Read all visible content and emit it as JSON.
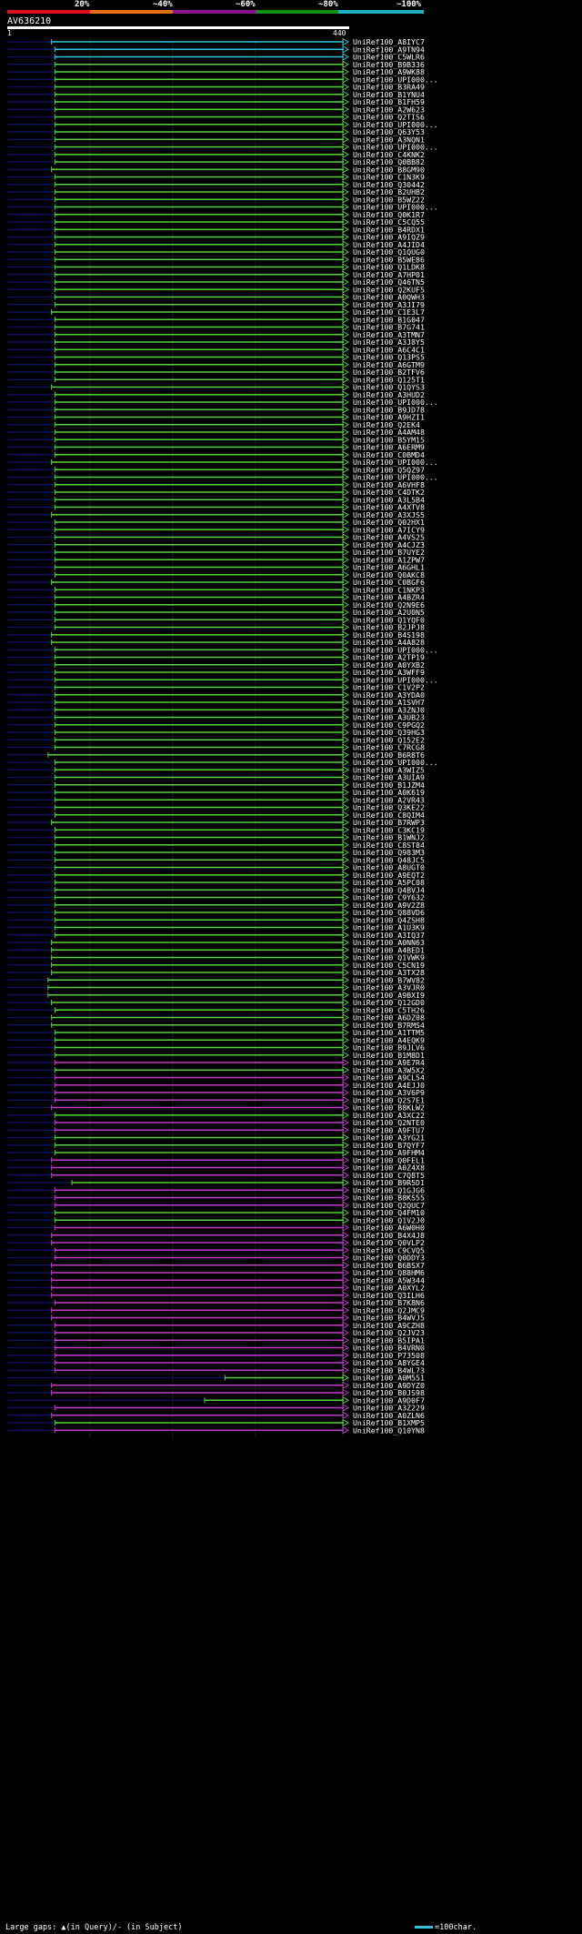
{
  "scale": {
    "labels": [
      "20%",
      "~40%",
      "~60%",
      "~80%",
      "~100%"
    ],
    "colors": [
      "#e0101e",
      "#e07010",
      "#8a128a",
      "#109010",
      "#20b0c0"
    ]
  },
  "query": {
    "name": "AV636210",
    "start": "1",
    "end": "440"
  },
  "colors": {
    "cyan": "#2ec4d6",
    "green": "#55d23c",
    "magenta": "#c03cc8",
    "navy": "#10105a",
    "gridline": "#1a1a1a"
  },
  "hits": [
    {
      "label": "UniRef100_A8IYC7",
      "color": "cyan",
      "start": 0.13
    },
    {
      "label": "UniRef100_A9TN94",
      "color": "cyan",
      "start": 0.14
    },
    {
      "label": "UniRef100_C5WLR6",
      "color": "cyan",
      "start": 0.14
    },
    {
      "label": "UniRef100_B9B336",
      "color": "green",
      "start": 0.14
    },
    {
      "label": "UniRef100_A9WK88",
      "color": "green",
      "start": 0.14
    },
    {
      "label": "UniRef100_UPI000...",
      "color": "green",
      "start": 0.14
    },
    {
      "label": "UniRef100_B3RA49",
      "color": "green",
      "start": 0.14
    },
    {
      "label": "UniRef100_B1YNU4",
      "color": "green",
      "start": 0.14
    },
    {
      "label": "UniRef100_B1FH59",
      "color": "green",
      "start": 0.14
    },
    {
      "label": "UniRef100_A2W623",
      "color": "green",
      "start": 0.14
    },
    {
      "label": "UniRef100_Q2TIS6",
      "color": "green",
      "start": 0.14
    },
    {
      "label": "UniRef100_UPI000...",
      "color": "green",
      "start": 0.14
    },
    {
      "label": "UniRef100_Q63Y53",
      "color": "green",
      "start": 0.14
    },
    {
      "label": "UniRef100_A3NQN1",
      "color": "green",
      "start": 0.14
    },
    {
      "label": "UniRef100_UPI000...",
      "color": "green",
      "start": 0.14
    },
    {
      "label": "UniRef100_C4KNK2",
      "color": "green",
      "start": 0.14
    },
    {
      "label": "UniRef100_Q0BB82",
      "color": "green",
      "start": 0.14
    },
    {
      "label": "UniRef100_B8GM90",
      "color": "green",
      "start": 0.13
    },
    {
      "label": "UniRef100_C1N3K9",
      "color": "green",
      "start": 0.14
    },
    {
      "label": "UniRef100_Q30442",
      "color": "green",
      "start": 0.14
    },
    {
      "label": "UniRef100_B2UHB2",
      "color": "green",
      "start": 0.14
    },
    {
      "label": "UniRef100_B5WZ22",
      "color": "green",
      "start": 0.14
    },
    {
      "label": "UniRef100_UPI000...",
      "color": "green",
      "start": 0.14
    },
    {
      "label": "UniRef100_Q0K1R7",
      "color": "green",
      "start": 0.14
    },
    {
      "label": "UniRef100_C5CQ55",
      "color": "green",
      "start": 0.14
    },
    {
      "label": "UniRef100_B4RDX1",
      "color": "green",
      "start": 0.14
    },
    {
      "label": "UniRef100_A9IQZ9",
      "color": "green",
      "start": 0.14
    },
    {
      "label": "UniRef100_A4JID4",
      "color": "green",
      "start": 0.14
    },
    {
      "label": "UniRef100_Q1QUG0",
      "color": "green",
      "start": 0.14
    },
    {
      "label": "UniRef100_B5WE86",
      "color": "green",
      "start": 0.14
    },
    {
      "label": "UniRef100_Q1LDK8",
      "color": "green",
      "start": 0.14
    },
    {
      "label": "UniRef100_A7HP01",
      "color": "green",
      "start": 0.14
    },
    {
      "label": "UniRef100_Q46TN5",
      "color": "green",
      "start": 0.14
    },
    {
      "label": "UniRef100_Q2KUF5",
      "color": "green",
      "start": 0.14
    },
    {
      "label": "UniRef100_A0QWH3",
      "color": "green",
      "start": 0.14
    },
    {
      "label": "UniRef100_A3JI79",
      "color": "green",
      "start": 0.14
    },
    {
      "label": "UniRef100_C1E3L7",
      "color": "green",
      "start": 0.13
    },
    {
      "label": "UniRef100_B1G047",
      "color": "green",
      "start": 0.14
    },
    {
      "label": "UniRef100_B7G741",
      "color": "green",
      "start": 0.14
    },
    {
      "label": "UniRef100_A3TMN7",
      "color": "green",
      "start": 0.14
    },
    {
      "label": "UniRef100_A3J8Y5",
      "color": "green",
      "start": 0.14
    },
    {
      "label": "UniRef100_A6C4C1",
      "color": "green",
      "start": 0.14
    },
    {
      "label": "UniRef100_Q13PS5",
      "color": "green",
      "start": 0.14
    },
    {
      "label": "UniRef100_A6GTM9",
      "color": "green",
      "start": 0.14
    },
    {
      "label": "UniRef100_B2TFV6",
      "color": "green",
      "start": 0.14
    },
    {
      "label": "UniRef100_Q125T1",
      "color": "green",
      "start": 0.14
    },
    {
      "label": "UniRef100_Q1QYS3",
      "color": "green",
      "start": 0.13
    },
    {
      "label": "UniRef100_A3HUD2",
      "color": "green",
      "start": 0.14
    },
    {
      "label": "UniRef100_UPI000...",
      "color": "green",
      "start": 0.14
    },
    {
      "label": "UniRef100_B9JD78",
      "color": "green",
      "start": 0.14
    },
    {
      "label": "UniRef100_A9HZI1",
      "color": "green",
      "start": 0.14
    },
    {
      "label": "UniRef100_Q2EK4",
      "color": "green",
      "start": 0.14
    },
    {
      "label": "UniRef100_A4AM48",
      "color": "green",
      "start": 0.14
    },
    {
      "label": "UniRef100_B5YM15",
      "color": "green",
      "start": 0.14
    },
    {
      "label": "UniRef100_A6ERM9",
      "color": "green",
      "start": 0.14
    },
    {
      "label": "UniRef100_C0BMD4",
      "color": "green",
      "start": 0.14
    },
    {
      "label": "UniRef100_UPI000...",
      "color": "green",
      "start": 0.13
    },
    {
      "label": "UniRef100_Q5QZ97",
      "color": "green",
      "start": 0.14
    },
    {
      "label": "UniRef100_UPI000...",
      "color": "green",
      "start": 0.14
    },
    {
      "label": "UniRef100_A6VHF8",
      "color": "green",
      "start": 0.14
    },
    {
      "label": "UniRef100_C4DTK2",
      "color": "green",
      "start": 0.14
    },
    {
      "label": "UniRef100_A3L5B4",
      "color": "green",
      "start": 0.14
    },
    {
      "label": "UniRef100_A4XTV8",
      "color": "green",
      "start": 0.14
    },
    {
      "label": "UniRef100_A3XJS5",
      "color": "green",
      "start": 0.13
    },
    {
      "label": "UniRef100_Q02HX1",
      "color": "green",
      "start": 0.14
    },
    {
      "label": "UniRef100_A7ICY9",
      "color": "green",
      "start": 0.14
    },
    {
      "label": "UniRef100_A4VS25",
      "color": "green",
      "start": 0.14
    },
    {
      "label": "UniRef100_A4CJZ3",
      "color": "green",
      "start": 0.14
    },
    {
      "label": "UniRef100_B7UYE2",
      "color": "green",
      "start": 0.14
    },
    {
      "label": "UniRef100_A1ZPW7",
      "color": "green",
      "start": 0.14
    },
    {
      "label": "UniRef100_A6GHL1",
      "color": "green",
      "start": 0.14
    },
    {
      "label": "UniRef100_Q0AKC8",
      "color": "green",
      "start": 0.14
    },
    {
      "label": "UniRef100_C0BGF6",
      "color": "green",
      "start": 0.13
    },
    {
      "label": "UniRef100_C1NKP3",
      "color": "green",
      "start": 0.14
    },
    {
      "label": "UniRef100_A4BZR4",
      "color": "green",
      "start": 0.14
    },
    {
      "label": "UniRef100_Q2N9E6",
      "color": "green",
      "start": 0.14
    },
    {
      "label": "UniRef100_A2U0N5",
      "color": "green",
      "start": 0.14
    },
    {
      "label": "UniRef100_Q1YQF0",
      "color": "green",
      "start": 0.14
    },
    {
      "label": "UniRef100_B2JPJ8",
      "color": "green",
      "start": 0.14
    },
    {
      "label": "UniRef100_B4S198",
      "color": "green",
      "start": 0.13
    },
    {
      "label": "UniRef100_A4A828",
      "color": "green",
      "start": 0.13
    },
    {
      "label": "UniRef100_UPI000...",
      "color": "green",
      "start": 0.14
    },
    {
      "label": "UniRef100_A2TP19",
      "color": "green",
      "start": 0.14
    },
    {
      "label": "UniRef100_A0YXB2",
      "color": "green",
      "start": 0.14
    },
    {
      "label": "UniRef100_A3WFF9",
      "color": "green",
      "start": 0.14
    },
    {
      "label": "UniRef100_UPI000...",
      "color": "green",
      "start": 0.14
    },
    {
      "label": "UniRef100_C1V2P2",
      "color": "green",
      "start": 0.14
    },
    {
      "label": "UniRef100_A3YDA0",
      "color": "green",
      "start": 0.14
    },
    {
      "label": "UniRef100_A1SVH7",
      "color": "green",
      "start": 0.14
    },
    {
      "label": "UniRef100_A3ZNJ0",
      "color": "green",
      "start": 0.14
    },
    {
      "label": "UniRef100_A3UB23",
      "color": "green",
      "start": 0.14
    },
    {
      "label": "UniRef100_C9PGQ2",
      "color": "green",
      "start": 0.14
    },
    {
      "label": "UniRef100_Q39HG3",
      "color": "green",
      "start": 0.14
    },
    {
      "label": "UniRef100_Q152E2",
      "color": "green",
      "start": 0.14
    },
    {
      "label": "UniRef100_C7RCG8",
      "color": "green",
      "start": 0.14
    },
    {
      "label": "UniRef100_B6R8T6",
      "color": "green",
      "start": 0.12
    },
    {
      "label": "UniRef100_UPI000...",
      "color": "green",
      "start": 0.14
    },
    {
      "label": "UniRef100_A3WIZ5",
      "color": "green",
      "start": 0.14
    },
    {
      "label": "UniRef100_A3UIA9",
      "color": "green",
      "start": 0.14
    },
    {
      "label": "UniRef100_B1JZM4",
      "color": "green",
      "start": 0.14
    },
    {
      "label": "UniRef100_A0K619",
      "color": "green",
      "start": 0.14
    },
    {
      "label": "UniRef100_A2VR43",
      "color": "green",
      "start": 0.14
    },
    {
      "label": "UniRef100_Q3KE22",
      "color": "green",
      "start": 0.14
    },
    {
      "label": "UniRef100_C8QIM4",
      "color": "green",
      "start": 0.14
    },
    {
      "label": "UniRef100_B7RWP3",
      "color": "green",
      "start": 0.13
    },
    {
      "label": "UniRef100_C3KC19",
      "color": "green",
      "start": 0.14
    },
    {
      "label": "UniRef100_B1WNJ2",
      "color": "green",
      "start": 0.14
    },
    {
      "label": "UniRef100_C8ST84",
      "color": "green",
      "start": 0.14
    },
    {
      "label": "UniRef100_Q983M3",
      "color": "green",
      "start": 0.14
    },
    {
      "label": "UniRef100_Q48JC5",
      "color": "green",
      "start": 0.14
    },
    {
      "label": "UniRef100_A8UGT0",
      "color": "green",
      "start": 0.14
    },
    {
      "label": "UniRef100_A9EQT2",
      "color": "green",
      "start": 0.14
    },
    {
      "label": "UniRef100_A5PC08",
      "color": "green",
      "start": 0.14
    },
    {
      "label": "UniRef100_Q4BVJ4",
      "color": "green",
      "start": 0.14
    },
    {
      "label": "UniRef100_C9Y632",
      "color": "green",
      "start": 0.14
    },
    {
      "label": "UniRef100_A9V2Z8",
      "color": "green",
      "start": 0.14
    },
    {
      "label": "UniRef100_Q88VD6",
      "color": "green",
      "start": 0.14
    },
    {
      "label": "UniRef100_Q4ZSH8",
      "color": "green",
      "start": 0.14
    },
    {
      "label": "UniRef100_A1U3K9",
      "color": "green",
      "start": 0.14
    },
    {
      "label": "UniRef100_A3IQ37",
      "color": "green",
      "start": 0.14
    },
    {
      "label": "UniRef100_A0NN63",
      "color": "green",
      "start": 0.13
    },
    {
      "label": "UniRef100_A4BED1",
      "color": "green",
      "start": 0.13
    },
    {
      "label": "UniRef100_Q1VWK9",
      "color": "green",
      "start": 0.13
    },
    {
      "label": "UniRef100_C5CN19",
      "color": "green",
      "start": 0.13
    },
    {
      "label": "UniRef100_A3TX28",
      "color": "green",
      "start": 0.13
    },
    {
      "label": "UniRef100_B7WV82",
      "color": "green",
      "start": 0.12
    },
    {
      "label": "UniRef100_A3VJR0",
      "color": "green",
      "start": 0.12
    },
    {
      "label": "UniRef100_A9BXI9",
      "color": "green",
      "start": 0.12
    },
    {
      "label": "UniRef100_Q12GD0",
      "color": "green",
      "start": 0.13
    },
    {
      "label": "UniRef100_C5TH26",
      "color": "green",
      "start": 0.14
    },
    {
      "label": "UniRef100_A6DZ08",
      "color": "green",
      "start": 0.13
    },
    {
      "label": "UniRef100_B7RMS4",
      "color": "green",
      "start": 0.13
    },
    {
      "label": "UniRef100_A1TTM5",
      "color": "green",
      "start": 0.14
    },
    {
      "label": "UniRef100_A4EQK9",
      "color": "green",
      "start": 0.14
    },
    {
      "label": "UniRef100_B9JLV6",
      "color": "green",
      "start": 0.14
    },
    {
      "label": "UniRef100_B1M8D1",
      "color": "green",
      "start": 0.14
    },
    {
      "label": "UniRef100_A9E7R4",
      "color": "magenta",
      "start": 0.14
    },
    {
      "label": "UniRef100_A3W5X2",
      "color": "green",
      "start": 0.14
    },
    {
      "label": "UniRef100_A9CL54",
      "color": "magenta",
      "start": 0.14
    },
    {
      "label": "UniRef100_A4EJJ0",
      "color": "magenta",
      "start": 0.14
    },
    {
      "label": "UniRef100_A3V6P9",
      "color": "magenta",
      "start": 0.14
    },
    {
      "label": "UniRef100_Q2S7E1",
      "color": "magenta",
      "start": 0.14
    },
    {
      "label": "UniRef100_B8KLW2",
      "color": "magenta",
      "start": 0.13
    },
    {
      "label": "UniRef100_A3XC22",
      "color": "green",
      "start": 0.14
    },
    {
      "label": "UniRef100_Q2NTE0",
      "color": "magenta",
      "start": 0.14
    },
    {
      "label": "UniRef100_A9FTU7",
      "color": "magenta",
      "start": 0.14
    },
    {
      "label": "UniRef100_A3YG21",
      "color": "green",
      "start": 0.14
    },
    {
      "label": "UniRef100_B7QYF7",
      "color": "green",
      "start": 0.14
    },
    {
      "label": "UniRef100_A9FHM4",
      "color": "green",
      "start": 0.14
    },
    {
      "label": "UniRef100_Q0FEL1",
      "color": "magenta",
      "start": 0.13
    },
    {
      "label": "UniRef100_A0Z4X8",
      "color": "magenta",
      "start": 0.13
    },
    {
      "label": "UniRef100_C7Q8T5",
      "color": "magenta",
      "start": 0.13
    },
    {
      "label": "UniRef100_B9R5D1",
      "color": "green",
      "start": 0.19
    },
    {
      "label": "UniRef100_Q1GJG6",
      "color": "magenta",
      "start": 0.14
    },
    {
      "label": "UniRef100_B8KS55",
      "color": "magenta",
      "start": 0.14
    },
    {
      "label": "UniRef100_Q2QUC7",
      "color": "magenta",
      "start": 0.14
    },
    {
      "label": "UniRef100_Q4FM10",
      "color": "green",
      "start": 0.14
    },
    {
      "label": "UniRef100_Q1V2J0",
      "color": "green",
      "start": 0.14
    },
    {
      "label": "UniRef100_A6W0H0",
      "color": "magenta",
      "start": 0.14
    },
    {
      "label": "UniRef100_B4X4J8",
      "color": "magenta",
      "start": 0.13
    },
    {
      "label": "UniRef100_Q0VLP2",
      "color": "magenta",
      "start": 0.13
    },
    {
      "label": "UniRef100_C9CVQ5",
      "color": "magenta",
      "start": 0.14
    },
    {
      "label": "UniRef100_Q0DDY3",
      "color": "magenta",
      "start": 0.14
    },
    {
      "label": "UniRef100_B6BSX7",
      "color": "magenta",
      "start": 0.13
    },
    {
      "label": "UniRef100_Q88HM6",
      "color": "magenta",
      "start": 0.13
    },
    {
      "label": "UniRef100_A5W344",
      "color": "magenta",
      "start": 0.13
    },
    {
      "label": "UniRef100_A0XYL2",
      "color": "magenta",
      "start": 0.13
    },
    {
      "label": "UniRef100_Q3ILH6",
      "color": "magenta",
      "start": 0.13
    },
    {
      "label": "UniRef100_B7K8N6",
      "color": "magenta",
      "start": 0.14
    },
    {
      "label": "UniRef100_Q2JMC9",
      "color": "magenta",
      "start": 0.13
    },
    {
      "label": "UniRef100_B4WVJ5",
      "color": "magenta",
      "start": 0.13
    },
    {
      "label": "UniRef100_A9CZH8",
      "color": "magenta",
      "start": 0.14
    },
    {
      "label": "UniRef100_Q2JV23",
      "color": "magenta",
      "start": 0.14
    },
    {
      "label": "UniRef100_B5IPA1",
      "color": "magenta",
      "start": 0.14
    },
    {
      "label": "UniRef100_B4VRN0",
      "color": "magenta",
      "start": 0.14
    },
    {
      "label": "UniRef100_P73508",
      "color": "magenta",
      "start": 0.14
    },
    {
      "label": "UniRef100_A8YGE4",
      "color": "magenta",
      "start": 0.14
    },
    {
      "label": "UniRef100_B4WL73",
      "color": "magenta",
      "start": 0.14
    },
    {
      "label": "UniRef100_A0M551",
      "color": "green",
      "start": 0.64
    },
    {
      "label": "UniRef100_A9DYZ0",
      "color": "magenta",
      "start": 0.13
    },
    {
      "label": "UniRef100_B0JS98",
      "color": "magenta",
      "start": 0.13
    },
    {
      "label": "UniRef100_A9D0F7",
      "color": "green",
      "start": 0.58
    },
    {
      "label": "UniRef100_A3Z229",
      "color": "magenta",
      "start": 0.14
    },
    {
      "label": "UniRef100_A0ZLN6",
      "color": "magenta",
      "start": 0.13
    },
    {
      "label": "UniRef100_B1XMP5",
      "color": "green",
      "start": 0.14
    },
    {
      "label": "UniRef100_Q10YN8",
      "color": "magenta",
      "start": 0.14
    }
  ],
  "footer": {
    "text": "Large gaps: ▲(in Query)/- (in Subject)",
    "legend": "=100char."
  }
}
